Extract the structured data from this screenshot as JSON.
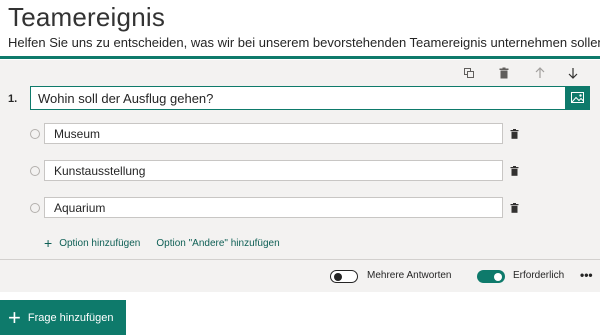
{
  "form": {
    "title": "Teamereignis",
    "description": "Helfen Sie uns zu entscheiden, was wir bei unserem bevorstehenden Teamereignis unternehmen sollen"
  },
  "question": {
    "number": "1.",
    "text": "Wohin soll der Ausflug gehen?",
    "options": [
      {
        "label": "Museum"
      },
      {
        "label": "Kunstausstellung"
      },
      {
        "label": "Aquarium"
      }
    ],
    "add_option_label": "Option hinzufügen",
    "add_other_label": "Option \"Andere\" hinzufügen",
    "multiple_answers": {
      "label": "Mehrere Antworten",
      "on": false
    },
    "required": {
      "label": "Erforderlich",
      "on": true
    },
    "more_label": "•••"
  },
  "add_question": {
    "plus": "+",
    "label": "Frage hinzufügen"
  },
  "colors": {
    "accent": "#0e7a6b",
    "card_background": "#f3f2f1",
    "link": "#0e5f55"
  },
  "icons": [
    "copy-icon",
    "trash-icon",
    "arrow-up-icon",
    "arrow-down-icon",
    "insert-image-icon",
    "radio-icon",
    "plus-icon",
    "more-icon"
  ]
}
